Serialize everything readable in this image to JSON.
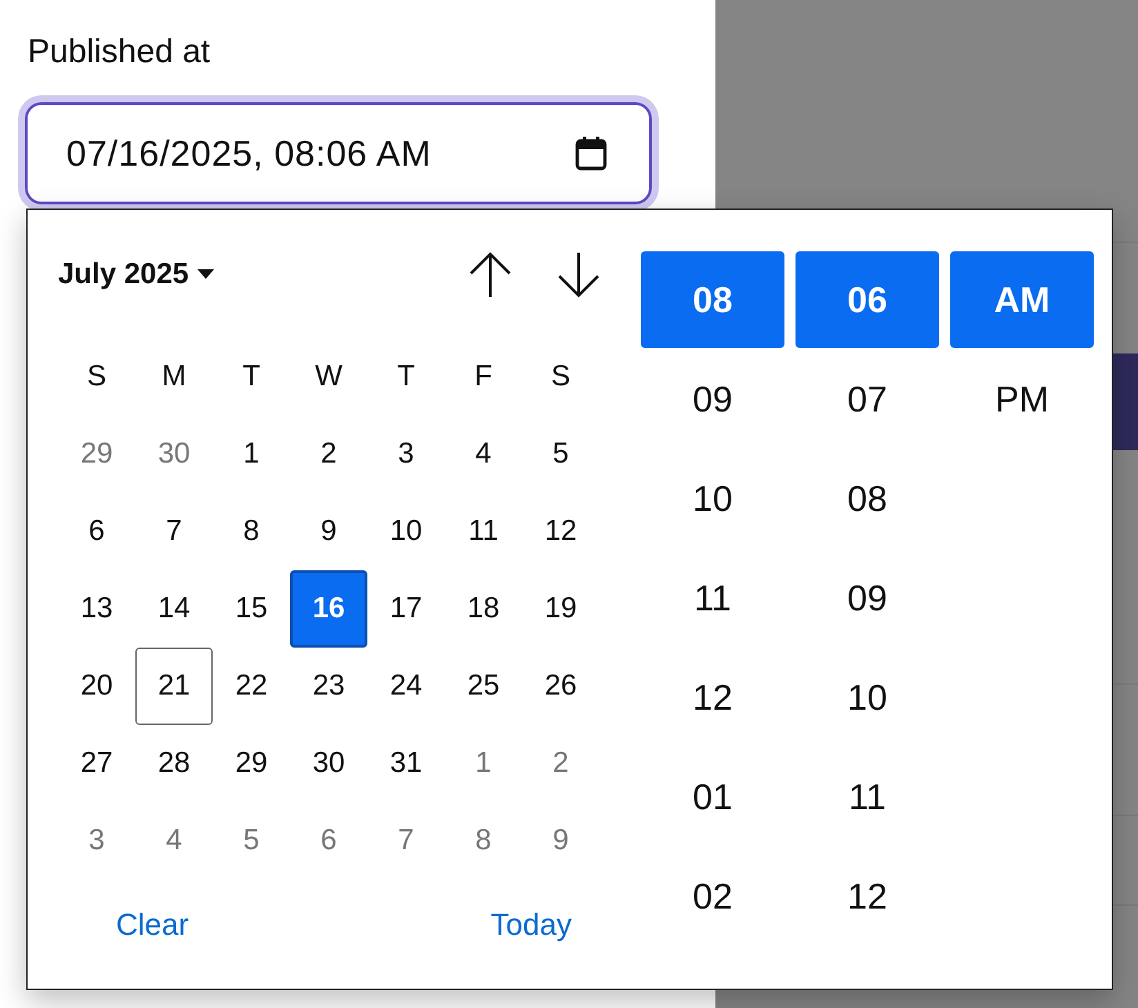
{
  "label": "Published at",
  "field": {
    "value": "07/16/2025, 08:06 AM"
  },
  "calendar": {
    "month": "July 2025",
    "weekdays": [
      "S",
      "M",
      "T",
      "W",
      "T",
      "F",
      "S"
    ],
    "days": [
      {
        "text": "29",
        "outside": true,
        "selected": false,
        "today": false
      },
      {
        "text": "30",
        "outside": true,
        "selected": false,
        "today": false
      },
      {
        "text": "1",
        "outside": false,
        "selected": false,
        "today": false
      },
      {
        "text": "2",
        "outside": false,
        "selected": false,
        "today": false
      },
      {
        "text": "3",
        "outside": false,
        "selected": false,
        "today": false
      },
      {
        "text": "4",
        "outside": false,
        "selected": false,
        "today": false
      },
      {
        "text": "5",
        "outside": false,
        "selected": false,
        "today": false
      },
      {
        "text": "6",
        "outside": false,
        "selected": false,
        "today": false
      },
      {
        "text": "7",
        "outside": false,
        "selected": false,
        "today": false
      },
      {
        "text": "8",
        "outside": false,
        "selected": false,
        "today": false
      },
      {
        "text": "9",
        "outside": false,
        "selected": false,
        "today": false
      },
      {
        "text": "10",
        "outside": false,
        "selected": false,
        "today": false
      },
      {
        "text": "11",
        "outside": false,
        "selected": false,
        "today": false
      },
      {
        "text": "12",
        "outside": false,
        "selected": false,
        "today": false
      },
      {
        "text": "13",
        "outside": false,
        "selected": false,
        "today": false
      },
      {
        "text": "14",
        "outside": false,
        "selected": false,
        "today": false
      },
      {
        "text": "15",
        "outside": false,
        "selected": false,
        "today": false
      },
      {
        "text": "16",
        "outside": false,
        "selected": true,
        "today": false
      },
      {
        "text": "17",
        "outside": false,
        "selected": false,
        "today": false
      },
      {
        "text": "18",
        "outside": false,
        "selected": false,
        "today": false
      },
      {
        "text": "19",
        "outside": false,
        "selected": false,
        "today": false
      },
      {
        "text": "20",
        "outside": false,
        "selected": false,
        "today": false
      },
      {
        "text": "21",
        "outside": false,
        "selected": false,
        "today": true
      },
      {
        "text": "22",
        "outside": false,
        "selected": false,
        "today": false
      },
      {
        "text": "23",
        "outside": false,
        "selected": false,
        "today": false
      },
      {
        "text": "24",
        "outside": false,
        "selected": false,
        "today": false
      },
      {
        "text": "25",
        "outside": false,
        "selected": false,
        "today": false
      },
      {
        "text": "26",
        "outside": false,
        "selected": false,
        "today": false
      },
      {
        "text": "27",
        "outside": false,
        "selected": false,
        "today": false
      },
      {
        "text": "28",
        "outside": false,
        "selected": false,
        "today": false
      },
      {
        "text": "29",
        "outside": false,
        "selected": false,
        "today": false
      },
      {
        "text": "30",
        "outside": false,
        "selected": false,
        "today": false
      },
      {
        "text": "31",
        "outside": false,
        "selected": false,
        "today": false
      },
      {
        "text": "1",
        "outside": true,
        "selected": false,
        "today": false
      },
      {
        "text": "2",
        "outside": true,
        "selected": false,
        "today": false
      },
      {
        "text": "3",
        "outside": true,
        "selected": false,
        "today": false
      },
      {
        "text": "4",
        "outside": true,
        "selected": false,
        "today": false
      },
      {
        "text": "5",
        "outside": true,
        "selected": false,
        "today": false
      },
      {
        "text": "6",
        "outside": true,
        "selected": false,
        "today": false
      },
      {
        "text": "7",
        "outside": true,
        "selected": false,
        "today": false
      },
      {
        "text": "8",
        "outside": true,
        "selected": false,
        "today": false
      },
      {
        "text": "9",
        "outside": true,
        "selected": false,
        "today": false
      }
    ],
    "actions": [
      "Clear",
      "Today"
    ]
  },
  "time": {
    "hours": [
      {
        "text": "08",
        "selected": true
      },
      {
        "text": "09",
        "selected": false
      },
      {
        "text": "10",
        "selected": false
      },
      {
        "text": "11",
        "selected": false
      },
      {
        "text": "12",
        "selected": false
      },
      {
        "text": "01",
        "selected": false
      },
      {
        "text": "02",
        "selected": false
      }
    ],
    "minutes": [
      {
        "text": "06",
        "selected": true
      },
      {
        "text": "07",
        "selected": false
      },
      {
        "text": "08",
        "selected": false
      },
      {
        "text": "09",
        "selected": false
      },
      {
        "text": "10",
        "selected": false
      },
      {
        "text": "11",
        "selected": false
      },
      {
        "text": "12",
        "selected": false
      }
    ],
    "periods": [
      {
        "text": "AM",
        "selected": true
      },
      {
        "text": "PM",
        "selected": false
      }
    ]
  }
}
